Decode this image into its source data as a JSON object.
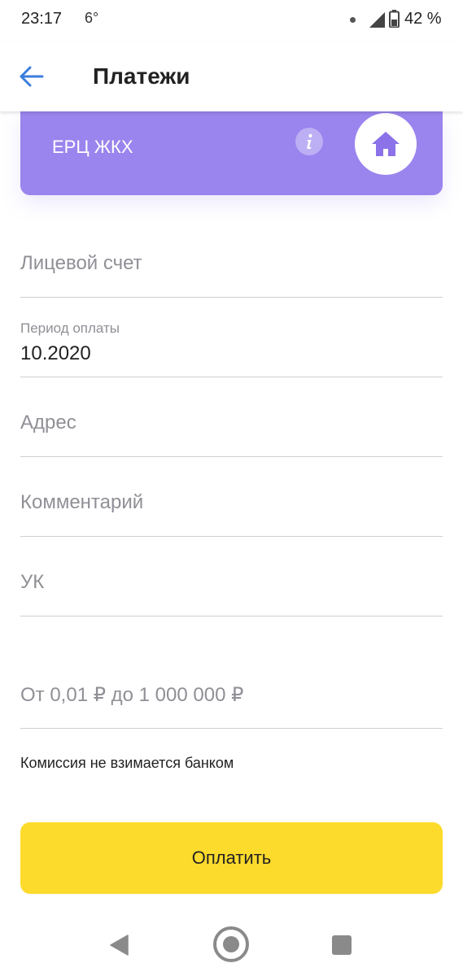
{
  "status_bar": {
    "time": "23:17",
    "temperature": "6°",
    "battery": "42 %"
  },
  "app_bar": {
    "title": "Платежи",
    "back_icon": "arrow-left-icon"
  },
  "provider": {
    "name": "ЕРЦ ЖКХ",
    "info_icon": "i",
    "icon": "home-icon",
    "color": "#9a84ee"
  },
  "form": {
    "account_placeholder": "Лицевой счет",
    "period_label": "Период оплаты",
    "period_value": "10.2020",
    "address_placeholder": "Адрес",
    "comment_placeholder": "Комментарий",
    "uk_placeholder": "УК",
    "amount_placeholder": "От 0,01 ₽ до 1 000 000 ₽"
  },
  "commission_note": "Комиссия не взимается банком",
  "pay_button": {
    "label": "Оплатить",
    "color": "#fddb2d"
  },
  "nav_bar": {
    "icons": [
      "back-triangle-icon",
      "home-circle-icon",
      "recents-square-icon"
    ]
  }
}
